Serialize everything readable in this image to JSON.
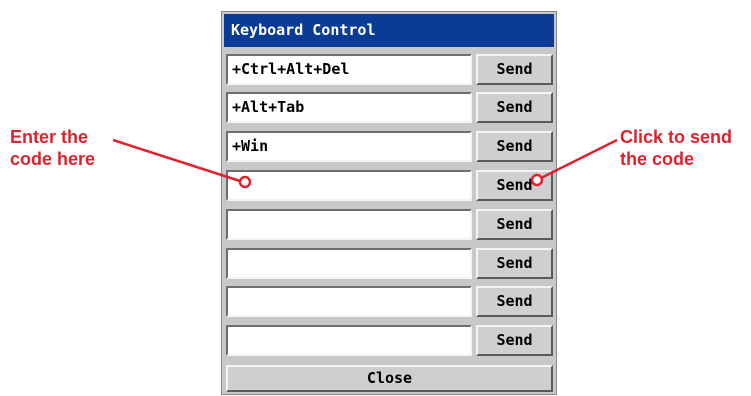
{
  "dialog": {
    "title": "Keyboard Control",
    "rows": [
      {
        "code": "+Ctrl+Alt+Del",
        "send_label": "Send"
      },
      {
        "code": "+Alt+Tab",
        "send_label": "Send"
      },
      {
        "code": "+Win",
        "send_label": "Send"
      },
      {
        "code": "",
        "send_label": "Send"
      },
      {
        "code": "",
        "send_label": "Send"
      },
      {
        "code": "",
        "send_label": "Send"
      },
      {
        "code": "",
        "send_label": "Send"
      },
      {
        "code": "",
        "send_label": "Send"
      }
    ],
    "close_label": "Close"
  },
  "callouts": {
    "left": {
      "line1": "Enter the",
      "line2": "code here"
    },
    "right": {
      "line1": "Click to send",
      "line2": "the code"
    }
  },
  "colors": {
    "titlebar": "#0a3c96",
    "panel": "#c8c8c8",
    "callout": "#e0222e"
  }
}
